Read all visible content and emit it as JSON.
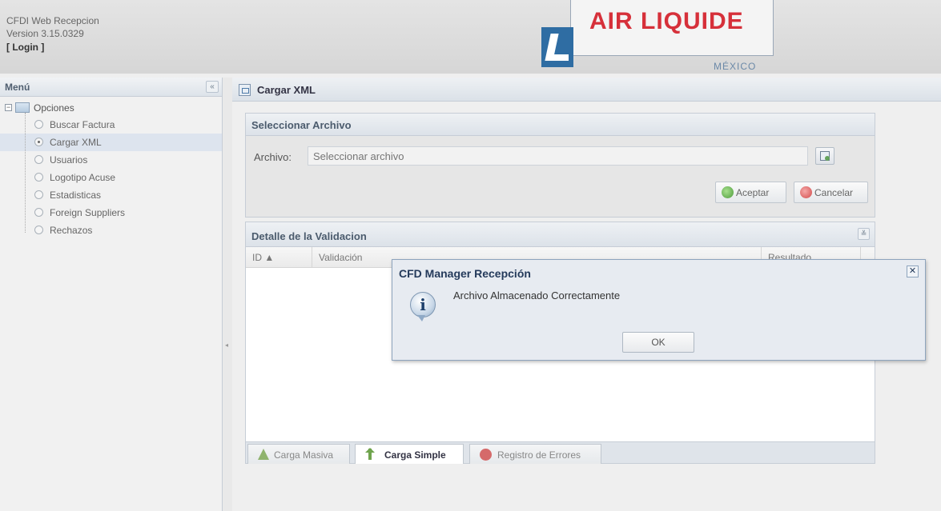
{
  "header": {
    "app_title": "CFDI Web Recepcion",
    "version": "Version 3.15.0329",
    "login_label": "[ Login ]",
    "logo_text": "AIR LIQUIDE",
    "logo_country": "MÉXICO"
  },
  "menu": {
    "title": "Menú",
    "collapse_glyph": "«",
    "root_label": "Opciones",
    "items": [
      {
        "label": "Buscar Factura",
        "selected": false
      },
      {
        "label": "Cargar XML",
        "selected": true
      },
      {
        "label": "Usuarios",
        "selected": false
      },
      {
        "label": "Logotipo Acuse",
        "selected": false
      },
      {
        "label": "Estadisticas",
        "selected": false
      },
      {
        "label": "Foreign Suppliers",
        "selected": false
      },
      {
        "label": "Rechazos",
        "selected": false
      }
    ]
  },
  "main": {
    "title": "Cargar XML",
    "select_panel": {
      "title": "Seleccionar Archivo",
      "file_label": "Archivo:",
      "file_placeholder": "Seleccionar archivo",
      "accept_label": "Aceptar",
      "cancel_label": "Cancelar"
    },
    "detail_panel": {
      "title": "Detalle de la Validacion",
      "columns": [
        "ID ▲",
        "Validación",
        "Resultado"
      ]
    },
    "tabs": [
      {
        "label": "Carga Masiva",
        "active": false
      },
      {
        "label": "Carga Simple",
        "active": true
      },
      {
        "label": "Registro de Errores",
        "active": false
      }
    ]
  },
  "modal": {
    "title": "CFD Manager Recepción",
    "message": "Archivo Almacenado Correctamente",
    "ok_label": "OK",
    "close_glyph": "✕",
    "icon": "info-icon"
  }
}
